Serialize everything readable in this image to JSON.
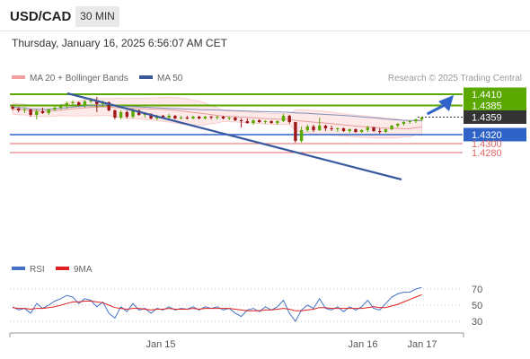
{
  "header": {
    "symbol": "USD/CAD",
    "timeframe": "30 MIN"
  },
  "timestamp": "Thursday, January 16, 2025 6:56:07 AM CET",
  "copyright": "Research © 2025 Trading Central",
  "colors": {
    "support": "#2f63c8",
    "resistance": "#5aa800",
    "minor": "#e06666",
    "price": "#333333",
    "ma20": "#e89a9a",
    "ma50": "#3b5998",
    "trend": "#3a5aa0",
    "arrow": "#2f63c8",
    "bull": "#5aa800",
    "bear": "#a01818",
    "rsi": "#4472c4",
    "rsi_ma": "#e02020"
  },
  "chart_data": [
    {
      "type": "candlestick",
      "legend": [
        "MA 20 + Bollinger Bands",
        "MA 50"
      ],
      "levels": [
        {
          "label": "1.4410",
          "value": 1.441,
          "kind": "resistance-box"
        },
        {
          "label": "1.4385",
          "value": 1.4385,
          "kind": "resistance-box"
        },
        {
          "label": "1.4359",
          "value": 1.4359,
          "kind": "price-box"
        },
        {
          "label": "1.4320",
          "value": 1.432,
          "kind": "support-box"
        },
        {
          "label": "1.4300",
          "value": 1.43,
          "kind": "minor"
        },
        {
          "label": "1.4280",
          "value": 1.428,
          "kind": "minor"
        }
      ],
      "x_ticks": [
        "Jan 15",
        "Jan 16",
        "Jan 17"
      ],
      "candles": [
        [
          1.4382,
          1.4386,
          1.4374,
          1.4378
        ],
        [
          1.4378,
          1.4382,
          1.437,
          1.4374
        ],
        [
          1.4374,
          1.438,
          1.4368,
          1.4376
        ],
        [
          1.4376,
          1.4378,
          1.436,
          1.4364
        ],
        [
          1.4364,
          1.4376,
          1.4354,
          1.4372
        ],
        [
          1.4372,
          1.438,
          1.4366,
          1.4368
        ],
        [
          1.4368,
          1.4378,
          1.4364,
          1.4376
        ],
        [
          1.4376,
          1.4384,
          1.4372,
          1.438
        ],
        [
          1.438,
          1.4388,
          1.4376,
          1.4384
        ],
        [
          1.4384,
          1.4394,
          1.4378,
          1.439
        ],
        [
          1.439,
          1.4396,
          1.4386,
          1.4392
        ],
        [
          1.4392,
          1.4394,
          1.4384,
          1.4386
        ],
        [
          1.4386,
          1.4398,
          1.438,
          1.4394
        ],
        [
          1.4394,
          1.4402,
          1.439,
          1.4396
        ],
        [
          1.4396,
          1.4404,
          1.437,
          1.4388
        ],
        [
          1.4388,
          1.4396,
          1.4382,
          1.4392
        ],
        [
          1.4392,
          1.4394,
          1.4372,
          1.4374
        ],
        [
          1.4374,
          1.4376,
          1.4354,
          1.4358
        ],
        [
          1.4358,
          1.4374,
          1.4354,
          1.437
        ],
        [
          1.437,
          1.4374,
          1.4356,
          1.436
        ],
        [
          1.436,
          1.4378,
          1.4356,
          1.4374
        ],
        [
          1.4374,
          1.4376,
          1.4362,
          1.4364
        ],
        [
          1.4364,
          1.4368,
          1.4358,
          1.4366
        ],
        [
          1.4366,
          1.4368,
          1.4354,
          1.4356
        ],
        [
          1.4356,
          1.4364,
          1.4352,
          1.4362
        ],
        [
          1.4362,
          1.4364,
          1.4356,
          1.4358
        ],
        [
          1.4358,
          1.4366,
          1.4354,
          1.4362
        ],
        [
          1.4362,
          1.4364,
          1.4354,
          1.4356
        ],
        [
          1.4356,
          1.4362,
          1.4354,
          1.4358
        ],
        [
          1.4358,
          1.4362,
          1.4354,
          1.4356
        ],
        [
          1.4356,
          1.4362,
          1.4354,
          1.436
        ],
        [
          1.436,
          1.4362,
          1.4354,
          1.4356
        ],
        [
          1.4356,
          1.4362,
          1.4354,
          1.436
        ],
        [
          1.436,
          1.4362,
          1.4354,
          1.4358
        ],
        [
          1.4358,
          1.4362,
          1.4354,
          1.436
        ],
        [
          1.436,
          1.4362,
          1.4354,
          1.4356
        ],
        [
          1.4356,
          1.436,
          1.4352,
          1.4358
        ],
        [
          1.4358,
          1.436,
          1.435,
          1.4352
        ],
        [
          1.4352,
          1.4356,
          1.4336,
          1.435
        ],
        [
          1.435,
          1.4356,
          1.4344,
          1.4346
        ],
        [
          1.4346,
          1.4354,
          1.4342,
          1.4352
        ],
        [
          1.4352,
          1.4354,
          1.4346,
          1.4348
        ],
        [
          1.4348,
          1.4352,
          1.4344,
          1.435
        ],
        [
          1.435,
          1.4352,
          1.4344,
          1.4346
        ],
        [
          1.4346,
          1.4352,
          1.4342,
          1.435
        ],
        [
          1.435,
          1.4366,
          1.4348,
          1.4362
        ],
        [
          1.4362,
          1.4364,
          1.4344,
          1.4348
        ],
        [
          1.4348,
          1.4344,
          1.4302,
          1.4306
        ],
        [
          1.4306,
          1.4338,
          1.4302,
          1.433
        ],
        [
          1.433,
          1.4342,
          1.4326,
          1.4338
        ],
        [
          1.4338,
          1.4342,
          1.4326,
          1.433
        ],
        [
          1.433,
          1.4358,
          1.4328,
          1.434
        ],
        [
          1.434,
          1.4342,
          1.4328,
          1.4334
        ],
        [
          1.4334,
          1.434,
          1.4328,
          1.4332
        ],
        [
          1.4332,
          1.4336,
          1.4326,
          1.4334
        ],
        [
          1.4334,
          1.4336,
          1.4326,
          1.4328
        ],
        [
          1.4328,
          1.4334,
          1.4324,
          1.4332
        ],
        [
          1.4332,
          1.4334,
          1.4324,
          1.4326
        ],
        [
          1.4326,
          1.4332,
          1.4324,
          1.433
        ],
        [
          1.433,
          1.434,
          1.4326,
          1.4336
        ],
        [
          1.4336,
          1.4338,
          1.4326,
          1.4328
        ],
        [
          1.4328,
          1.4334,
          1.4322,
          1.4326
        ],
        [
          1.4326,
          1.4334,
          1.4324,
          1.4332
        ],
        [
          1.4332,
          1.4342,
          1.433,
          1.434
        ],
        [
          1.434,
          1.4346,
          1.4336,
          1.4344
        ],
        [
          1.4344,
          1.435,
          1.434,
          1.4348
        ],
        [
          1.4348,
          1.4352,
          1.4344,
          1.435
        ],
        [
          1.435,
          1.4356,
          1.4346,
          1.4354
        ],
        [
          1.4354,
          1.436,
          1.435,
          1.4358
        ]
      ]
    },
    {
      "type": "line",
      "legend": [
        "RSI",
        "9MA"
      ],
      "y_ticks": [
        70,
        50,
        30
      ],
      "series": [
        {
          "name": "RSI",
          "values": [
            48,
            44,
            46,
            40,
            52,
            46,
            50,
            55,
            58,
            62,
            60,
            52,
            58,
            56,
            48,
            54,
            40,
            34,
            48,
            42,
            52,
            44,
            46,
            40,
            46,
            44,
            48,
            44,
            46,
            45,
            48,
            44,
            48,
            46,
            48,
            44,
            46,
            40,
            36,
            44,
            46,
            42,
            48,
            44,
            48,
            56,
            40,
            30,
            44,
            50,
            46,
            58,
            46,
            44,
            48,
            42,
            48,
            44,
            48,
            56,
            46,
            44,
            52,
            60,
            64,
            66,
            66,
            70,
            72
          ]
        },
        {
          "name": "9MA",
          "values": [
            47,
            46,
            46,
            45,
            46,
            46,
            47,
            48,
            50,
            52,
            54,
            54,
            55,
            55,
            54,
            53,
            50,
            47,
            46,
            45,
            46,
            46,
            45,
            44,
            45,
            45,
            46,
            45,
            45,
            45,
            46,
            45,
            46,
            46,
            46,
            46,
            46,
            45,
            44,
            43,
            43,
            43,
            44,
            44,
            45,
            46,
            45,
            43,
            43,
            44,
            45,
            47,
            47,
            46,
            46,
            46,
            46,
            46,
            46,
            47,
            48,
            47,
            47,
            49,
            51,
            54,
            57,
            60,
            63
          ]
        }
      ]
    }
  ]
}
